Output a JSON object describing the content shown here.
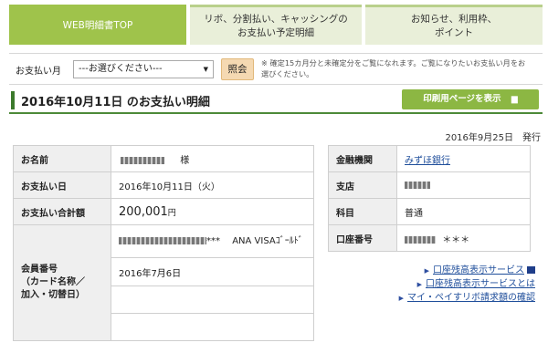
{
  "tabs": [
    {
      "label": "WEB明細書TOP"
    },
    {
      "label": "リボ、分割払い、キャッシングの\nお支払い予定明細"
    },
    {
      "label": "お知らせ、利用枠、\nポイント"
    }
  ],
  "search": {
    "label": "お支払い月",
    "select_value": "---お選びください---",
    "button_label": "照会",
    "note": "※ 確定15カ月分と未確定分をご覧になれます。ご覧になりたいお支払い月をお選びください。"
  },
  "title": {
    "text": "2016年10月11日 のお支払い明細",
    "print_label": "印刷用ページを表示"
  },
  "issued": "2016年9月25日　発行",
  "left_table": {
    "name_label": "お名前",
    "name_suffix": "様",
    "pay_date_label": "お支払い日",
    "pay_date_value": "2016年10月11日（火）",
    "total_label": "お支払い合計額",
    "total_value": "200,001",
    "total_unit": "円",
    "member_label": "会員番号\n（カード名称／\n加入・切替日）",
    "card_mask": "***",
    "card_name": "ANA VISAｺﾞｰﾙﾄﾞ",
    "join_date": "2016年7月6日"
  },
  "right_table": {
    "bank_label": "金融機関",
    "bank_value": "みずほ銀行",
    "branch_label": "支店",
    "type_label": "科目",
    "type_value": "普通",
    "account_label": "口座番号",
    "account_mask": "＊＊＊"
  },
  "links": [
    {
      "label": "口座残高表示サービス"
    },
    {
      "label": "口座残高表示サービスとは"
    },
    {
      "label": "マイ・ペイすリボ請求額の確認"
    }
  ],
  "colors": {
    "accent_green": "#9fc34b",
    "title_green": "#4d8a38",
    "link_blue": "#1f4e9b"
  }
}
